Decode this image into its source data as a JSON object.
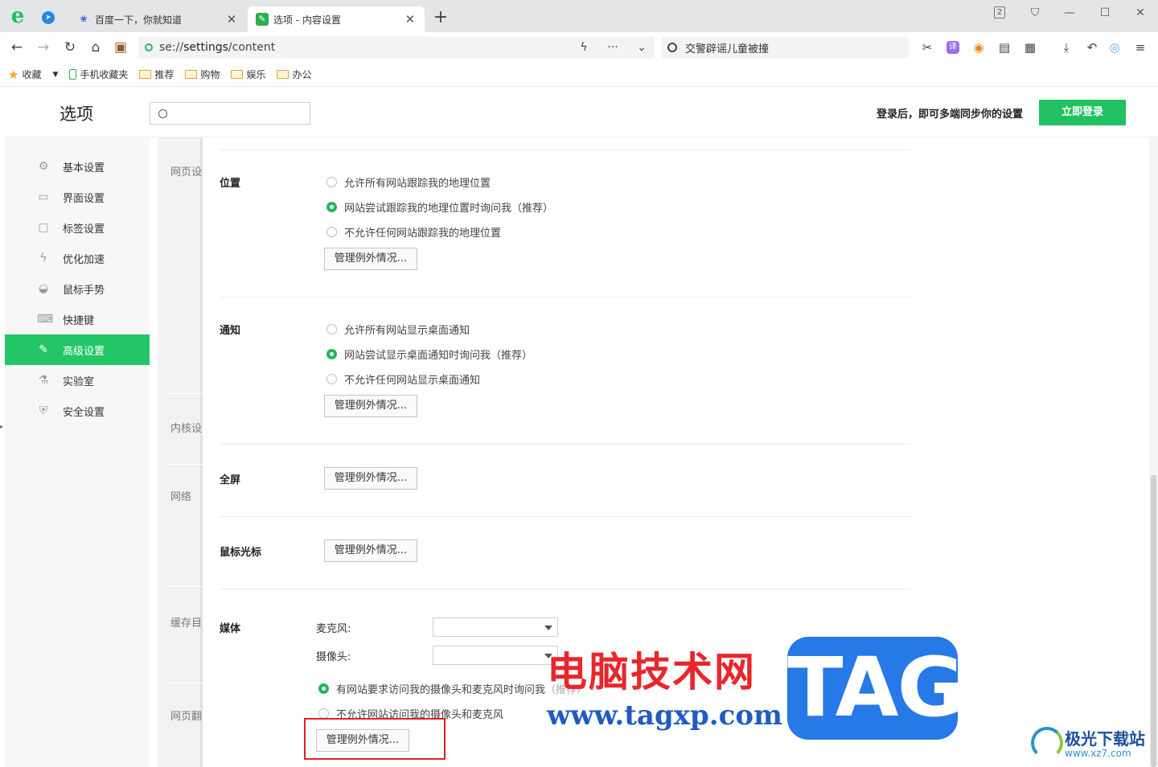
{
  "tabs": [
    {
      "title": "百度一下，你就知道",
      "active": false
    },
    {
      "title": "选项 - 内容设置",
      "active": true
    }
  ],
  "window": {
    "tab_count": "2"
  },
  "address": {
    "scheme": "se://",
    "host": "settings",
    "path": "/content"
  },
  "search": {
    "text": "交警辟谣儿童被撞"
  },
  "toolbar": {
    "translate_label": "译"
  },
  "bookmarks": [
    {
      "label": "收藏",
      "type": "star"
    },
    {
      "label": "手机收藏夹",
      "type": "phone"
    },
    {
      "label": "推荐",
      "type": "folder"
    },
    {
      "label": "购物",
      "type": "folder"
    },
    {
      "label": "娱乐",
      "type": "folder"
    },
    {
      "label": "办公",
      "type": "folder"
    }
  ],
  "settings": {
    "title": "选项",
    "login_tip": "登录后，即可多端同步你的设置",
    "login_button": "立即登录"
  },
  "sidebar": {
    "items": [
      {
        "label": "基本设置",
        "icon": "gear-icon"
      },
      {
        "label": "界面设置",
        "icon": "window-icon"
      },
      {
        "label": "标签设置",
        "icon": "tab-icon"
      },
      {
        "label": "优化加速",
        "icon": "lightning-icon"
      },
      {
        "label": "鼠标手势",
        "icon": "mouse-icon"
      },
      {
        "label": "快捷键",
        "icon": "keyboard-icon"
      },
      {
        "label": "高级设置",
        "icon": "wrench-icon",
        "active": true
      },
      {
        "label": "实验室",
        "icon": "flask-icon"
      },
      {
        "label": "安全设置",
        "icon": "shield-icon"
      }
    ]
  },
  "section_nav": [
    "网页设",
    "内核设",
    "网络",
    "缓存目",
    "网页翻"
  ],
  "content": {
    "location": {
      "label": "位置",
      "options": [
        {
          "text": "允许所有网站跟踪我的地理位置",
          "checked": false
        },
        {
          "text": "网站尝试跟踪我的地理位置时询问我（推荐）",
          "checked": true
        },
        {
          "text": "不允许任何网站跟踪我的地理位置",
          "checked": false
        }
      ],
      "button": "管理例外情况..."
    },
    "notification": {
      "label": "通知",
      "options": [
        {
          "text": "允许所有网站显示桌面通知",
          "checked": false
        },
        {
          "text": "网站尝试显示桌面通知时询问我（推荐）",
          "checked": true
        },
        {
          "text": "不允许任何网站显示桌面通知",
          "checked": false
        }
      ],
      "button": "管理例外情况..."
    },
    "fullscreen": {
      "label": "全屏",
      "button": "管理例外情况..."
    },
    "mouse_cursor": {
      "label": "鼠标光标",
      "button": "管理例外情况..."
    },
    "media": {
      "label": "媒体",
      "mic_label": "麦克风:",
      "camera_label": "摄像头:",
      "options": [
        {
          "text": "有网站要求访问我的摄像头和麦克风时询问我",
          "suffix": "（推荐）",
          "checked": true
        },
        {
          "text": "不允许网站访问我的摄像头和麦克风",
          "checked": false
        }
      ],
      "button": "管理例外情况..."
    }
  },
  "watermark": {
    "site_cn": "电脑技术网",
    "site_url": "www.tagxp.com",
    "tag": "TAG",
    "brand2": "极光下载站",
    "brand2_url": "www.xz7.com"
  }
}
